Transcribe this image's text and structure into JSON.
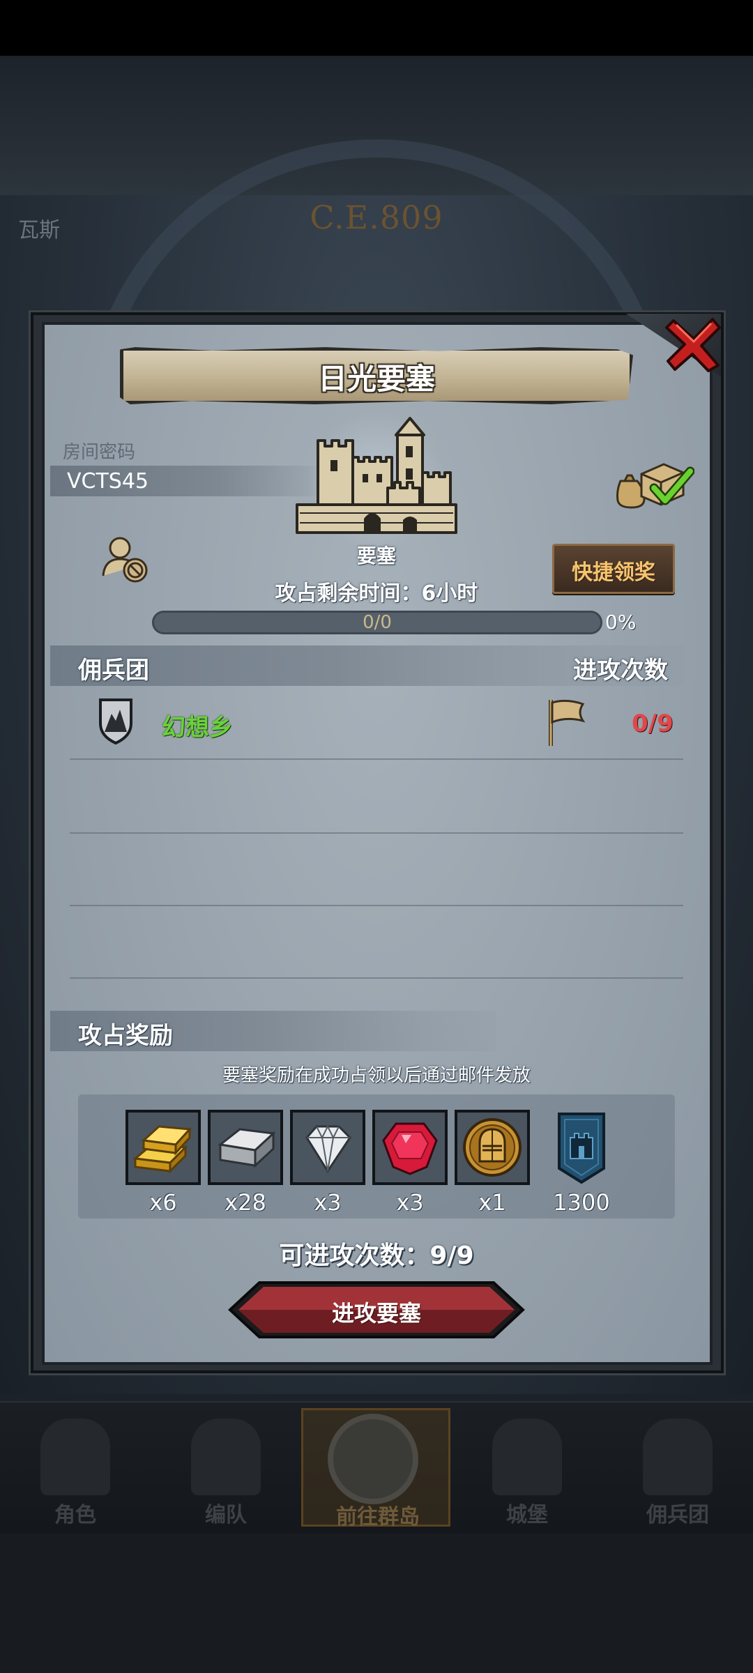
{
  "background": {
    "era": "C.E.809",
    "city_fragment": "瓦斯",
    "nav": [
      {
        "label": "角色"
      },
      {
        "label": "编队"
      },
      {
        "label": "前往群岛",
        "active": true
      },
      {
        "label": "城堡"
      },
      {
        "label": "佣兵团"
      }
    ]
  },
  "dialog": {
    "title": "日光要塞",
    "room": {
      "label": "房间密码",
      "code": "VCTS45"
    },
    "fortress_label": "要塞",
    "quick_claim_label": "快捷领奖",
    "time_remaining": "攻占剩余时间：6小时",
    "progress": {
      "text": "0/0",
      "percent_label": "0%",
      "fraction": 0
    },
    "mercenary_section": {
      "title": "佣兵团",
      "attack_header": "进攻次数"
    },
    "mercenaries": [
      {
        "name": "幻想乡",
        "attacks": "0/9"
      }
    ],
    "rewards_section": {
      "title": "攻占奖励",
      "note": "要塞奖励在成功占领以后通过邮件发放"
    },
    "rewards": [
      {
        "icon": "gold-bars-icon",
        "qty": "x6"
      },
      {
        "icon": "iron-ingot-icon",
        "qty": "x28"
      },
      {
        "icon": "diamond-icon",
        "qty": "x3"
      },
      {
        "icon": "ruby-icon",
        "qty": "x3"
      },
      {
        "icon": "knight-helmet-coin-icon",
        "qty": "x1"
      },
      {
        "icon": "fortress-banner-icon",
        "qty": "1300"
      }
    ],
    "remaining_attacks": "可进攻次数：9/9",
    "attack_button_label": "进攻要塞"
  },
  "colors": {
    "merc_name": "#69d23a",
    "attack_count": "#e0484a",
    "quick_claim_text": "#f7c46e",
    "attack_button": "#8a2a2e"
  }
}
